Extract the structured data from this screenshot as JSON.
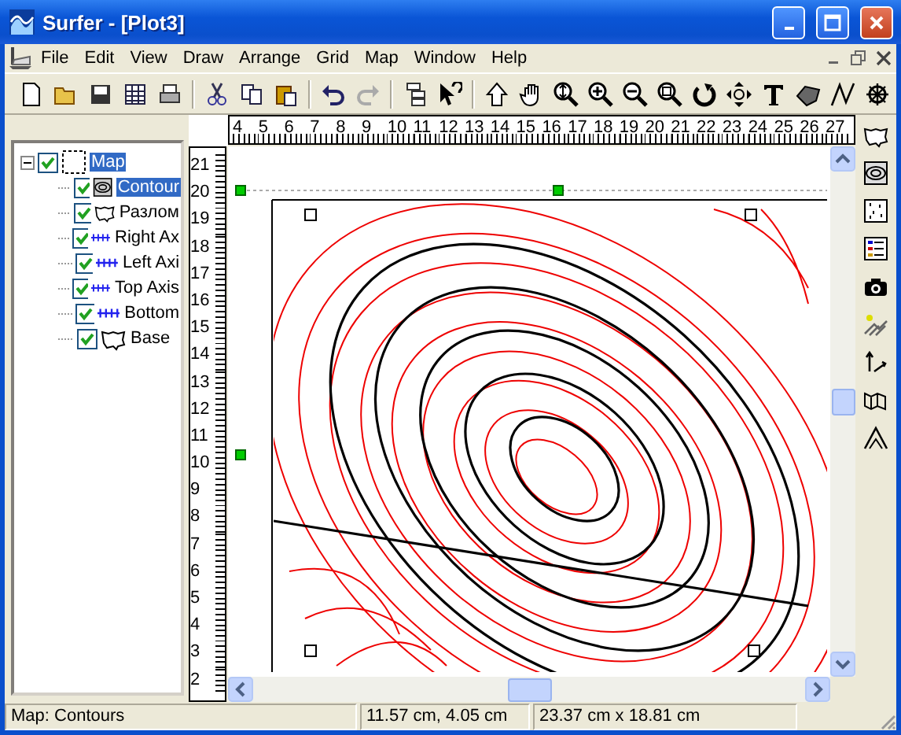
{
  "window": {
    "title": "Surfer - [Plot3]"
  },
  "menu": [
    "File",
    "Edit",
    "View",
    "Draw",
    "Arrange",
    "Grid",
    "Map",
    "Window",
    "Help"
  ],
  "tree": [
    {
      "label": "Map",
      "kind": "map",
      "checked": true,
      "selected": true,
      "expanded": true,
      "children": [
        {
          "label": "Contour",
          "kind": "contour",
          "checked": true,
          "selected": true
        },
        {
          "label": "Разлом",
          "kind": "base",
          "checked": true,
          "selected": false
        },
        {
          "label": "Right Ax",
          "kind": "axis",
          "checked": true,
          "selected": false
        },
        {
          "label": "Left Axi",
          "kind": "axis",
          "checked": true,
          "selected": false
        },
        {
          "label": "Top Axis",
          "kind": "axis",
          "checked": true,
          "selected": false
        },
        {
          "label": "Bottom",
          "kind": "axis",
          "checked": true,
          "selected": false
        },
        {
          "label": "Base",
          "kind": "base",
          "checked": true,
          "selected": false
        }
      ]
    }
  ],
  "horizontal_ruler": [
    "4",
    "5",
    "6",
    "7",
    "8",
    "9",
    "10",
    "11",
    "12",
    "13",
    "14",
    "15",
    "16",
    "17",
    "18",
    "19",
    "20",
    "21",
    "22",
    "23",
    "24",
    "25",
    "26",
    "27"
  ],
  "vertical_ruler": [
    "21",
    "20",
    "19",
    "18",
    "17",
    "16",
    "15",
    "14",
    "13",
    "12",
    "11",
    "10",
    "9",
    "8",
    "7",
    "6",
    "5",
    "4",
    "3",
    "2"
  ],
  "status_bar": [
    "Map: Contours",
    "11.57 cm, 4.05 cm",
    "23.37 cm x 18.81 cm"
  ]
}
